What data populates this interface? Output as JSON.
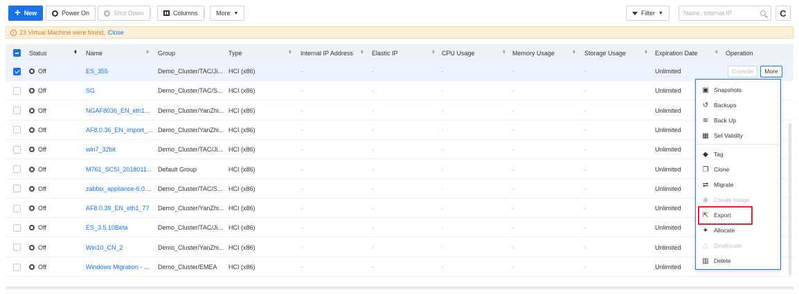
{
  "toolbar": {
    "new_label": "New",
    "power_on_label": "Power On",
    "shut_down_label": "Shut Down",
    "columns_label": "Columns",
    "more_label": "More",
    "filter_label": "Filter",
    "search_placeholder": "Name, Internal IP"
  },
  "banner": {
    "message": "23 Virtual Machine were found,",
    "close_label": "Close"
  },
  "columns": [
    "Status",
    "Name",
    "Group",
    "Type",
    "Internal IP Address",
    "Elastic IP",
    "CPU Usage",
    "Memory Usage",
    "Storage Usage",
    "Expiration Date",
    "Operation"
  ],
  "rows": [
    {
      "status": "Off",
      "name": "ES_355",
      "group": "Demo_Cluster/TAC/Ji...",
      "type": "HCI (x86)",
      "ip": "-",
      "eip": "-",
      "cpu": "-",
      "mem": "-",
      "storage": "-",
      "expiration": "Unlimited",
      "selected": true
    },
    {
      "status": "Off",
      "name": "SG",
      "group": "Demo_Cluster/TAC/S...",
      "type": "HCI (x86)",
      "ip": "-",
      "eip": "-",
      "cpu": "-",
      "mem": "-",
      "storage": "-",
      "expiration": "Unlimited",
      "selected": false
    },
    {
      "status": "Off",
      "name": "NGAF8036_EN_eth1...",
      "group": "Demo_Cluster/YanZhi...",
      "type": "HCI (x86)",
      "ip": "-",
      "eip": "-",
      "cpu": "-",
      "mem": "-",
      "storage": "-",
      "expiration": "Unlimited",
      "selected": false
    },
    {
      "status": "Off",
      "name": "AF8.0.36_EN_import_...",
      "group": "Demo_Cluster/YanZhi...",
      "type": "HCI (x86)",
      "ip": "-",
      "eip": "-",
      "cpu": "-",
      "mem": "-",
      "storage": "-",
      "expiration": "Unlimited",
      "selected": false
    },
    {
      "status": "Off",
      "name": "win7_32bit",
      "group": "Demo_Cluster/TAC/Ji...",
      "type": "HCI (x86)",
      "ip": "-",
      "eip": "-",
      "cpu": "-",
      "mem": "-",
      "storage": "-",
      "expiration": "Unlimited",
      "selected": false
    },
    {
      "status": "Off",
      "name": "M761_SCSI_2018011...",
      "group": "Default Group",
      "type": "HCI (x86)",
      "ip": "-",
      "eip": "-",
      "cpu": "-",
      "mem": "-",
      "storage": "-",
      "expiration": "Unlimited",
      "selected": false
    },
    {
      "status": "Off",
      "name": "zabbix_appliance-6.0....",
      "group": "Demo_Cluster/TAC/S...",
      "type": "HCI (x86)",
      "ip": "-",
      "eip": "-",
      "cpu": "-",
      "mem": "-",
      "storage": "-",
      "expiration": "Unlimited",
      "selected": false
    },
    {
      "status": "Off",
      "name": "AF8.0.39_EN_eth1_77",
      "group": "Demo_Cluster/YanZhi...",
      "type": "HCI (x86)",
      "ip": "-",
      "eip": "-",
      "cpu": "-",
      "mem": "-",
      "storage": "-",
      "expiration": "Unlimited",
      "selected": false
    },
    {
      "status": "Off",
      "name": "ES_3.5.10Beta",
      "group": "Demo_Cluster/TAC/Ji...",
      "type": "HCI (x86)",
      "ip": "-",
      "eip": "-",
      "cpu": "-",
      "mem": "-",
      "storage": "-",
      "expiration": "Unlimited",
      "selected": false
    },
    {
      "status": "Off",
      "name": "Win10_CN_2",
      "group": "Demo_Cluster/YanZhi...",
      "type": "HCI (x86)",
      "ip": "-",
      "eip": "-",
      "cpu": "-",
      "mem": "-",
      "storage": "-",
      "expiration": "Unlimited",
      "selected": false
    },
    {
      "status": "Off",
      "name": "Windows Migration - ...",
      "group": "Demo_Cluster/EMEA",
      "type": "HCI (x86)",
      "ip": "-",
      "eip": "-",
      "cpu": "-",
      "mem": "-",
      "storage": "-",
      "expiration": "Unlimited",
      "selected": false
    }
  ],
  "operation": {
    "console_label": "Console",
    "more_label": "More"
  },
  "menu": [
    {
      "label": "Snapshots",
      "icon": "camera-icon",
      "disabled": false
    },
    {
      "label": "Backups",
      "icon": "history-icon",
      "disabled": false
    },
    {
      "label": "Back Up",
      "icon": "database-icon",
      "disabled": false
    },
    {
      "label": "Set Validity",
      "icon": "calendar-icon",
      "disabled": false
    },
    {
      "label": "Tag",
      "icon": "tag-icon",
      "disabled": false
    },
    {
      "label": "Clone",
      "icon": "clone-icon",
      "disabled": false
    },
    {
      "label": "Migrate",
      "icon": "migrate-icon",
      "disabled": false
    },
    {
      "label": "Create Image",
      "icon": "image-icon",
      "disabled": true
    },
    {
      "label": "Export",
      "icon": "export-icon",
      "disabled": false
    },
    {
      "label": "Allocate",
      "icon": "allocate-icon",
      "disabled": false
    },
    {
      "label": "Deallocate",
      "icon": "deallocate-icon",
      "disabled": true
    },
    {
      "label": "Delete",
      "icon": "trash-icon",
      "disabled": false
    }
  ],
  "colors": {
    "accent": "#1a73e8",
    "banner_bg": "#fdf0d8",
    "banner_text": "#e07b16",
    "highlight": "#e0282e"
  }
}
